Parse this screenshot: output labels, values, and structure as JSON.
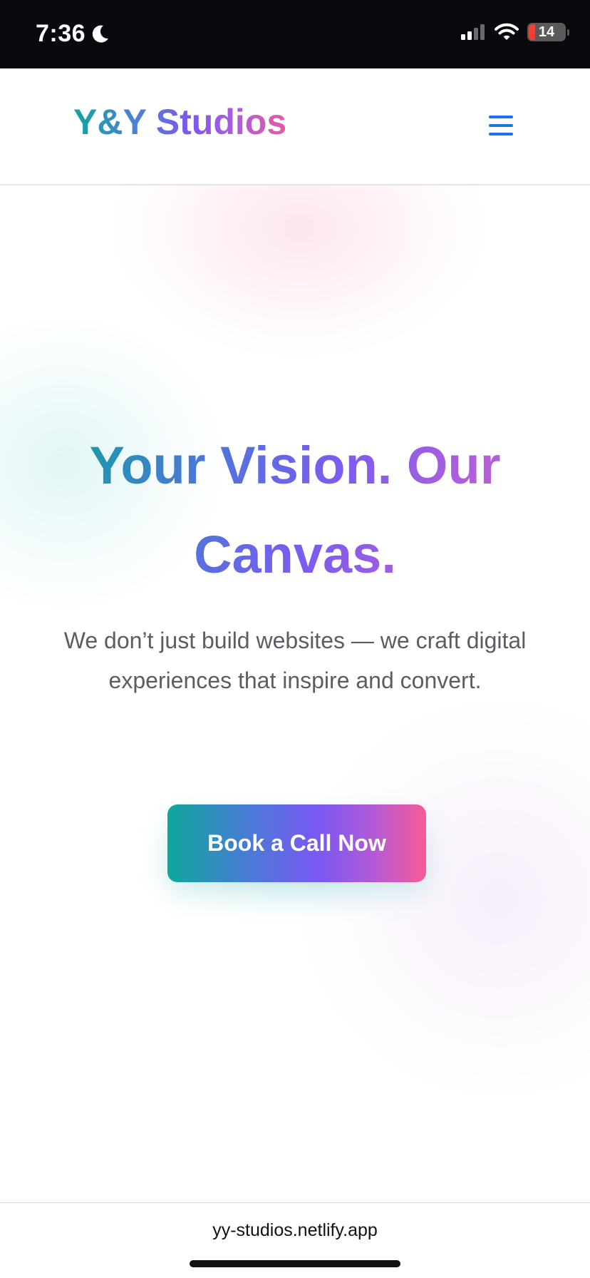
{
  "status_bar": {
    "time": "7:36",
    "battery_level": "14",
    "icons": [
      "moon-icon",
      "cellular-signal-icon",
      "wifi-icon",
      "battery-icon"
    ]
  },
  "header": {
    "logo_text": "Y&Y Studios",
    "menu_icon": "hamburger-menu-icon"
  },
  "hero": {
    "title": "Your Vision. Our Canvas.",
    "subtitle": "We don’t just build websites — we craft digital experiences that inspire and convert.",
    "cta_label": "Book a Call Now"
  },
  "browser": {
    "url": "yy-studios.netlify.app"
  },
  "colors": {
    "status_bar_bg": "#0b080f",
    "menu_icon": "#1a73e8",
    "gradient_teal": "#12a4a0",
    "gradient_violet": "#7a59ef",
    "gradient_pink": "#f95a96",
    "subtitle_text": "#5d5b63",
    "battery_low": "#ea4335"
  }
}
